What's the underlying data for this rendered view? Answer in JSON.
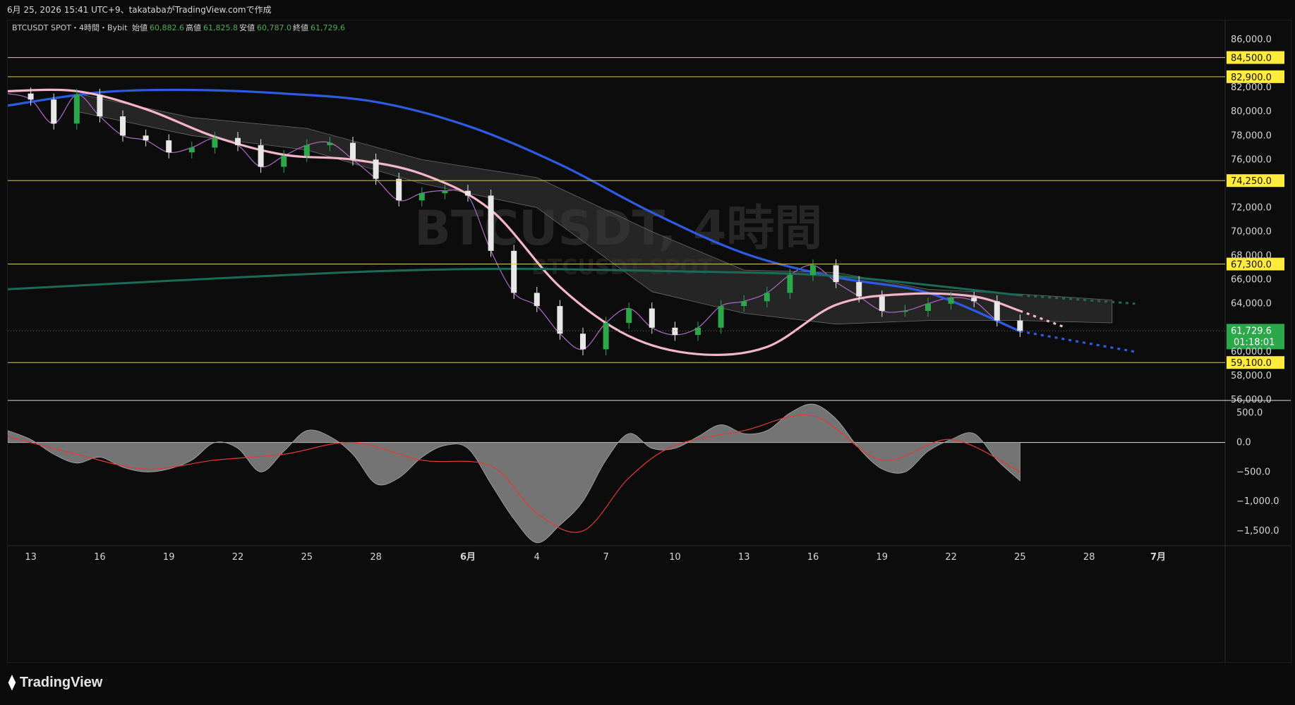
{
  "header": {
    "caption": "6月 25, 2026 15:41 UTC+9、takatabaがTradingView.comで作成"
  },
  "legend": {
    "symbol_line": "BTCUSDT SPOT・4時間・Bybit",
    "open_label": "始値",
    "open": "60,882.6",
    "high_label": "高値",
    "high": "61,825.8",
    "low_label": "安値",
    "low": "60,787.0",
    "close_label": "終値",
    "close": "61,729.6"
  },
  "watermark": {
    "big": "BTCUSDT, 4時間",
    "small": "BTCUSDT SPOT"
  },
  "brand": {
    "name": "TradingView",
    "icon": "tradingview-logo-icon"
  },
  "colors": {
    "up": "#2aa84a",
    "down": "#e8e8e8",
    "hline": "#d9c96a",
    "tag_bg": "#ffeb3b",
    "price_tag_bg": "#2aa84a",
    "blue_ma": "#2d5be3",
    "pink_ma": "#f4b6c8",
    "teal_ma": "#1b6b5a",
    "osc_fill": "#7f7f7f",
    "signal": "#e53935"
  },
  "chart_data": [
    {
      "type": "line",
      "title": "BTCUSDT SPOT・4時間・Bybit",
      "x_tick_labels": [
        "13",
        "16",
        "19",
        "22",
        "25",
        "28",
        "6月",
        "4",
        "7",
        "10",
        "13",
        "16",
        "19",
        "22",
        "25",
        "28",
        "7月"
      ],
      "y_tick_labels": [
        "86,000.0",
        "82,000.0",
        "80,000.0",
        "78,000.0",
        "76,000.0",
        "72,000.0",
        "70,000.0",
        "68,000.0",
        "66,000.0",
        "64,000.0",
        "60,000.0",
        "58,000.0",
        "56,000.0"
      ],
      "ylim": [
        56000,
        87000
      ],
      "horizontal_levels": [
        {
          "value": 84500,
          "label": "84,500.0"
        },
        {
          "value": 82900,
          "label": "82,900.0"
        },
        {
          "value": 74250,
          "label": "74,250.0"
        },
        {
          "value": 67300,
          "label": "67,300.0"
        },
        {
          "value": 59100,
          "label": "59,100.0"
        }
      ],
      "last_price": {
        "value": 61729.6,
        "label": "61,729.6",
        "countdown": "01:18:01"
      },
      "series": [
        {
          "name": "close",
          "x": [
            "5/12",
            "5/13",
            "5/14",
            "5/15",
            "5/16",
            "5/17",
            "5/18",
            "5/19",
            "5/20",
            "5/21",
            "5/22",
            "5/23",
            "5/24",
            "5/25",
            "5/26",
            "5/27",
            "5/28",
            "5/29",
            "5/30",
            "5/31",
            "6/1",
            "6/2",
            "6/3",
            "6/4",
            "6/5",
            "6/6",
            "6/7",
            "6/8",
            "6/9",
            "6/10",
            "6/11",
            "6/12",
            "6/13",
            "6/14",
            "6/15",
            "6/16",
            "6/17",
            "6/18",
            "6/19",
            "6/20",
            "6/21",
            "6/22",
            "6/23",
            "6/24",
            "6/25"
          ],
          "values": [
            81500,
            81000,
            79000,
            81400,
            79600,
            78000,
            77600,
            76600,
            77000,
            77800,
            77200,
            75400,
            76300,
            77200,
            77400,
            76000,
            74400,
            72600,
            73200,
            73400,
            73000,
            68400,
            64900,
            63800,
            61500,
            60200,
            62400,
            63600,
            62000,
            61400,
            62000,
            63800,
            64200,
            64900,
            66400,
            67200,
            65800,
            64600,
            63400,
            63400,
            64000,
            64500,
            64200,
            62600,
            61729.6
          ]
        },
        {
          "name": "long MA",
          "x": [
            "5/12",
            "5/16",
            "5/20",
            "5/24",
            "5/28",
            "6/1",
            "6/5",
            "6/9",
            "6/13",
            "6/17",
            "6/21",
            "6/25",
            "6/30"
          ],
          "values": [
            80500,
            81600,
            81800,
            81500,
            80800,
            78800,
            75600,
            71600,
            68200,
            66200,
            64900,
            61700,
            60000
          ]
        },
        {
          "name": "short MA",
          "x": [
            "5/12",
            "5/15",
            "5/18",
            "5/21",
            "5/24",
            "5/27",
            "5/30",
            "6/2",
            "6/5",
            "6/8",
            "6/11",
            "6/14",
            "6/17",
            "6/20",
            "6/23",
            "6/25",
            "6/27"
          ],
          "values": [
            81700,
            81700,
            80200,
            77900,
            76400,
            76000,
            74800,
            71800,
            65400,
            61300,
            59800,
            60400,
            63900,
            64800,
            64600,
            63400,
            62000
          ]
        },
        {
          "name": "MA 200",
          "x": [
            "5/12",
            "5/20",
            "5/28",
            "6/3",
            "6/10",
            "6/17",
            "6/25",
            "6/30"
          ],
          "values": [
            65200,
            66000,
            66700,
            66900,
            66700,
            66300,
            64700,
            64000
          ]
        }
      ]
    },
    {
      "type": "area",
      "y_tick_labels": [
        "500.0",
        "0.0",
        "−500.0",
        "−1,000.0",
        "−1,500.0"
      ],
      "ylim": [
        -1750,
        700
      ],
      "series": [
        {
          "name": "histogram",
          "x": [
            "5/12",
            "5/13",
            "5/14",
            "5/15",
            "5/16",
            "5/17",
            "5/18",
            "5/19",
            "5/20",
            "5/21",
            "5/22",
            "5/23",
            "5/24",
            "5/25",
            "5/26",
            "5/27",
            "5/28",
            "5/29",
            "5/30",
            "5/31",
            "6/1",
            "6/2",
            "6/3",
            "6/4",
            "6/5",
            "6/6",
            "6/7",
            "6/8",
            "6/9",
            "6/10",
            "6/11",
            "6/12",
            "6/13",
            "6/14",
            "6/15",
            "6/16",
            "6/17",
            "6/18",
            "6/19",
            "6/20",
            "6/21",
            "6/22",
            "6/23",
            "6/24",
            "6/25"
          ],
          "values": [
            200,
            50,
            -200,
            -350,
            -250,
            -420,
            -500,
            -450,
            -300,
            0,
            -100,
            -500,
            -150,
            200,
            100,
            -200,
            -700,
            -600,
            -250,
            -50,
            -100,
            -700,
            -1300,
            -1700,
            -1400,
            -1000,
            -300,
            150,
            -100,
            -100,
            100,
            300,
            150,
            200,
            500,
            650,
            400,
            -100,
            -450,
            -500,
            -150,
            50,
            150,
            -300,
            -650
          ]
        },
        {
          "name": "signal",
          "x": [
            "5/12",
            "5/15",
            "5/18",
            "5/21",
            "5/24",
            "5/27",
            "5/30",
            "6/2",
            "6/4",
            "6/6",
            "6/8",
            "6/10",
            "6/13",
            "6/16",
            "6/19",
            "6/22",
            "6/25"
          ],
          "values": [
            100,
            -200,
            -450,
            -300,
            -200,
            0,
            -300,
            -400,
            -1200,
            -1500,
            -600,
            -50,
            200,
            450,
            -300,
            50,
            -500
          ]
        }
      ]
    }
  ]
}
